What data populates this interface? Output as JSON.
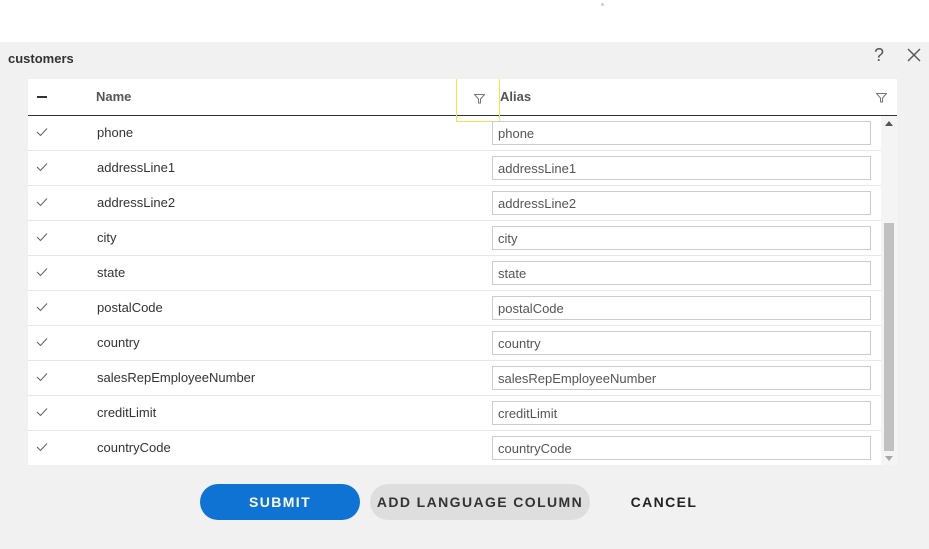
{
  "dialog": {
    "title": "customers",
    "help_symbol": "?"
  },
  "grid": {
    "columns": {
      "name": "Name",
      "alias": "Alias"
    },
    "rows": [
      {
        "name": "phone",
        "alias": "phone"
      },
      {
        "name": "addressLine1",
        "alias": "addressLine1"
      },
      {
        "name": "addressLine2",
        "alias": "addressLine2"
      },
      {
        "name": "city",
        "alias": "city"
      },
      {
        "name": "state",
        "alias": "state"
      },
      {
        "name": "postalCode",
        "alias": "postalCode"
      },
      {
        "name": "country",
        "alias": "country"
      },
      {
        "name": "salesRepEmployeeNumber",
        "alias": "salesRepEmployeeNumber"
      },
      {
        "name": "creditLimit",
        "alias": "creditLimit"
      },
      {
        "name": "countryCode",
        "alias": "countryCode"
      }
    ]
  },
  "buttons": {
    "submit": "SUBMIT",
    "add_language_column": "ADD LANGUAGE COLUMN",
    "cancel": "CANCEL"
  },
  "icons": {
    "help": "help-icon",
    "close": "close-icon",
    "filter": "filter-icon",
    "check": "check-icon",
    "select_all": "minus-icon"
  },
  "colors": {
    "primary": "#0f73d4",
    "secondary_button": "#dedede",
    "dialog_background": "#f1f1f1",
    "filter_highlight": "#f3e44a"
  }
}
